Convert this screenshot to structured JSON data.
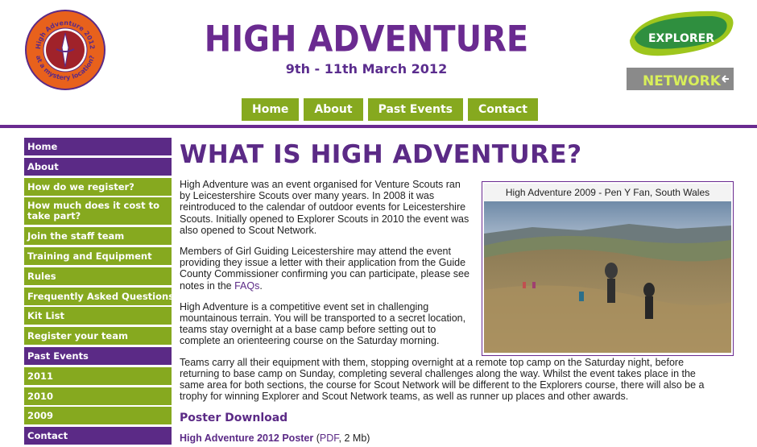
{
  "header": {
    "title": "HIGH ADVENTURE",
    "dates": "9th - 11th March 2012",
    "badge_text_top": "High Adventure 2012",
    "badge_text_bottom": "at a mystery location?",
    "explorer_logo_text": "EXPLORER",
    "network_logo_text": "NETWORK"
  },
  "topnav": {
    "items": [
      {
        "label": "Home"
      },
      {
        "label": "About"
      },
      {
        "label": "Past Events"
      },
      {
        "label": "Contact"
      }
    ]
  },
  "colors": {
    "purple": "#5b2a86",
    "green": "#86a91f",
    "orange": "#e8611c"
  },
  "sidebar": {
    "items": [
      {
        "label": "Home",
        "style": "purple"
      },
      {
        "label": "About",
        "style": "purple"
      },
      {
        "label": "How do we register?",
        "style": "green"
      },
      {
        "label": "How much does it cost to take part?",
        "style": "green"
      },
      {
        "label": "Join the staff team",
        "style": "green"
      },
      {
        "label": "Training and Equipment",
        "style": "green"
      },
      {
        "label": "Rules",
        "style": "green"
      },
      {
        "label": "Frequently Asked Questions",
        "style": "green"
      },
      {
        "label": "Kit List",
        "style": "green"
      },
      {
        "label": "Register your team",
        "style": "green"
      },
      {
        "label": "Past Events",
        "style": "purple"
      },
      {
        "label": "2011",
        "style": "green"
      },
      {
        "label": "2010",
        "style": "green"
      },
      {
        "label": "2009",
        "style": "green"
      },
      {
        "label": "Contact",
        "style": "purple"
      }
    ]
  },
  "main": {
    "heading": "WHAT IS HIGH ADVENTURE?",
    "para1": "High Adventure was an event organised for Venture Scouts ran by Leicestershire Scouts over many years. In 2008 it was reintroduced to the calendar of outdoor events for Leicestershire Scouts. Initially opened to Explorer Scouts in 2010 the event was also opened to Scout Network.",
    "para2_pre": "Members of Girl Guiding Leicestershire may attend the event providing they issue a letter with their application from the Guide County Commissioner confirming you can participate, please see notes in the ",
    "para2_link": "FAQs",
    "para2_post": ".",
    "para3": "High Adventure is a competitive event set in challenging mountainous terrain. You will be transported to a secret location, teams stay overnight at a base camp before setting out to complete an orienteering course on the Saturday morning.",
    "para4": "Teams carry all their equipment with them, stopping overnight at a remote top camp on the Saturday night, before returning to base camp on Sunday, completing several challenges along the way. Whilst the event takes place in the same area for both sections, the course for Scout Network will be different to the Explorers course, there will also be a trophy for winning Explorer and Scout Network teams, as well as runner up places and other awards.",
    "poster_heading": "Poster Download",
    "poster_link": "High Adventure 2012 Poster",
    "poster_open": " (",
    "poster_pdf": "PDF",
    "poster_close": ", 2 Mb)"
  },
  "photo": {
    "caption": "High Adventure 2009 - Pen Y Fan, South Wales"
  }
}
